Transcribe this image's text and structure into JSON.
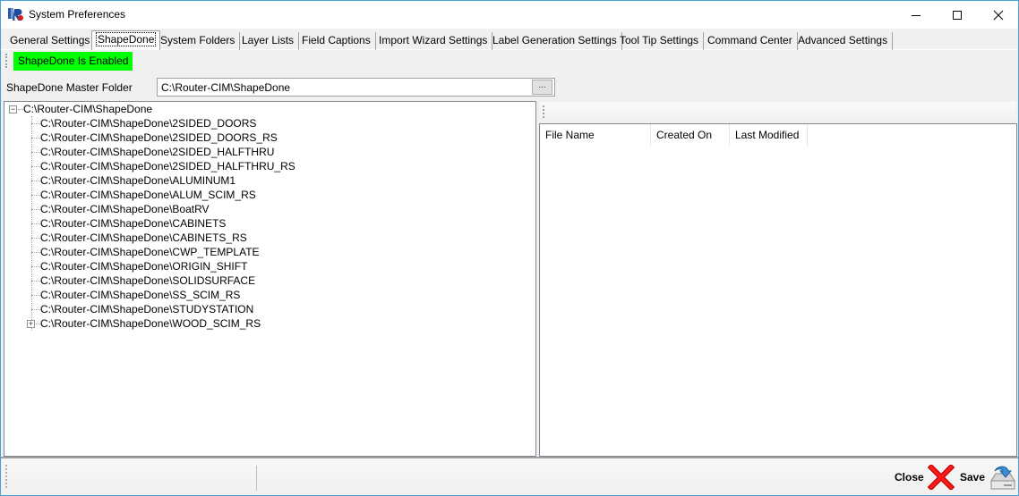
{
  "window": {
    "title": "System Preferences",
    "controls": {
      "minimize": "minimize-icon",
      "maximize": "maximize-icon",
      "close": "close-icon"
    }
  },
  "tabs": [
    {
      "label": "General Settings",
      "active": false
    },
    {
      "label": "ShapeDone",
      "active": true
    },
    {
      "label": "System Folders",
      "active": false
    },
    {
      "label": "Layer Lists",
      "active": false
    },
    {
      "label": "Field Captions",
      "active": false
    },
    {
      "label": "Import Wizard Settings",
      "active": false
    },
    {
      "label": "Label Generation Settings",
      "active": false
    },
    {
      "label": "Tool Tip Settings",
      "active": false
    },
    {
      "label": "Command Center",
      "active": false
    },
    {
      "label": "Advanced Settings",
      "active": false
    }
  ],
  "status_badge": {
    "text": "ShapeDone Is Enabled",
    "color": "#00ff00"
  },
  "master_folder": {
    "label": "ShapeDone Master Folder",
    "value": "C:\\Router-CIM\\ShapeDone",
    "browse_label": "..."
  },
  "tree": {
    "root": {
      "label": "C:\\Router-CIM\\ShapeDone",
      "expanded": true
    },
    "children": [
      {
        "label": "C:\\Router-CIM\\ShapeDone\\2SIDED_DOORS",
        "has_children": false
      },
      {
        "label": "C:\\Router-CIM\\ShapeDone\\2SIDED_DOORS_RS",
        "has_children": false
      },
      {
        "label": "C:\\Router-CIM\\ShapeDone\\2SIDED_HALFTHRU",
        "has_children": false
      },
      {
        "label": "C:\\Router-CIM\\ShapeDone\\2SIDED_HALFTHRU_RS",
        "has_children": false
      },
      {
        "label": "C:\\Router-CIM\\ShapeDone\\ALUMINUM1",
        "has_children": false
      },
      {
        "label": "C:\\Router-CIM\\ShapeDone\\ALUM_SCIM_RS",
        "has_children": false
      },
      {
        "label": "C:\\Router-CIM\\ShapeDone\\BoatRV",
        "has_children": false
      },
      {
        "label": "C:\\Router-CIM\\ShapeDone\\CABINETS",
        "has_children": false
      },
      {
        "label": "C:\\Router-CIM\\ShapeDone\\CABINETS_RS",
        "has_children": false
      },
      {
        "label": "C:\\Router-CIM\\ShapeDone\\CWP_TEMPLATE",
        "has_children": false
      },
      {
        "label": "C:\\Router-CIM\\ShapeDone\\ORIGIN_SHIFT",
        "has_children": false
      },
      {
        "label": "C:\\Router-CIM\\ShapeDone\\SOLIDSURFACE",
        "has_children": false
      },
      {
        "label": "C:\\Router-CIM\\ShapeDone\\SS_SCIM_RS",
        "has_children": false
      },
      {
        "label": "C:\\Router-CIM\\ShapeDone\\STUDYSTATION",
        "has_children": false
      },
      {
        "label": "C:\\Router-CIM\\ShapeDone\\WOOD_SCIM_RS",
        "has_children": true
      }
    ]
  },
  "file_list": {
    "columns": [
      "File Name",
      "Created On",
      "Last Modified"
    ],
    "rows": []
  },
  "footer": {
    "close_label": "Close",
    "save_label": "Save"
  }
}
